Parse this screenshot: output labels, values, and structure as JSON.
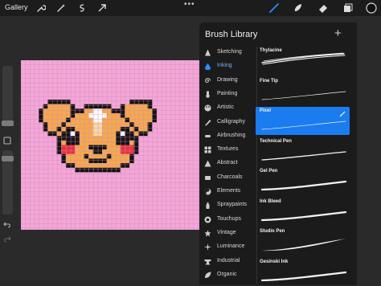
{
  "topbar": {
    "gallery_label": "Gallery",
    "tools": [
      "wrench-icon",
      "wand-icon",
      "selection-icon",
      "move-icon"
    ],
    "right_tools": [
      "brush-icon",
      "smudge-icon",
      "eraser-icon",
      "layers-icon",
      "color-swatch"
    ],
    "accent": "#2e8bff"
  },
  "brush_library": {
    "title": "Brush Library",
    "add_label": "+",
    "categories": [
      {
        "label": "Sketching",
        "icon": "pencil-tip-icon"
      },
      {
        "label": "Inking",
        "icon": "ink-drop-icon",
        "active": true
      },
      {
        "label": "Drawing",
        "icon": "spiral-icon"
      },
      {
        "label": "Painting",
        "icon": "paint-brush-icon"
      },
      {
        "label": "Artistic",
        "icon": "palette-icon"
      },
      {
        "label": "Calligraphy",
        "icon": "calligraphy-icon"
      },
      {
        "label": "Airbrushing",
        "icon": "airbrush-icon"
      },
      {
        "label": "Textures",
        "icon": "grid-icon"
      },
      {
        "label": "Abstract",
        "icon": "triangle-icon"
      },
      {
        "label": "Charcoals",
        "icon": "charcoal-icon"
      },
      {
        "label": "Elements",
        "icon": "yin-yang-icon"
      },
      {
        "label": "Spraypaints",
        "icon": "spray-can-icon"
      },
      {
        "label": "Touchups",
        "icon": "touchup-icon"
      },
      {
        "label": "Vintage",
        "icon": "vintage-icon"
      },
      {
        "label": "Luminance",
        "icon": "sparkle-icon"
      },
      {
        "label": "Industrial",
        "icon": "anvil-icon"
      },
      {
        "label": "Organic",
        "icon": "leaf-icon"
      }
    ],
    "brushes": [
      {
        "name": "Thylacine",
        "stroke": "textured"
      },
      {
        "name": "Fine Tip",
        "stroke": "thin"
      },
      {
        "name": "Pixel",
        "stroke": "thin",
        "selected": true
      },
      {
        "name": "Technical Pen",
        "stroke": "medium"
      },
      {
        "name": "Gel Pen",
        "stroke": "bold"
      },
      {
        "name": "Ink Bleed",
        "stroke": "bold"
      },
      {
        "name": "Studio Pen",
        "stroke": "tapered"
      },
      {
        "name": "Gesinski Ink",
        "stroke": "bold"
      }
    ]
  },
  "canvas": {
    "background": "#f4a6d8",
    "grid_color": "#c98ab3"
  }
}
